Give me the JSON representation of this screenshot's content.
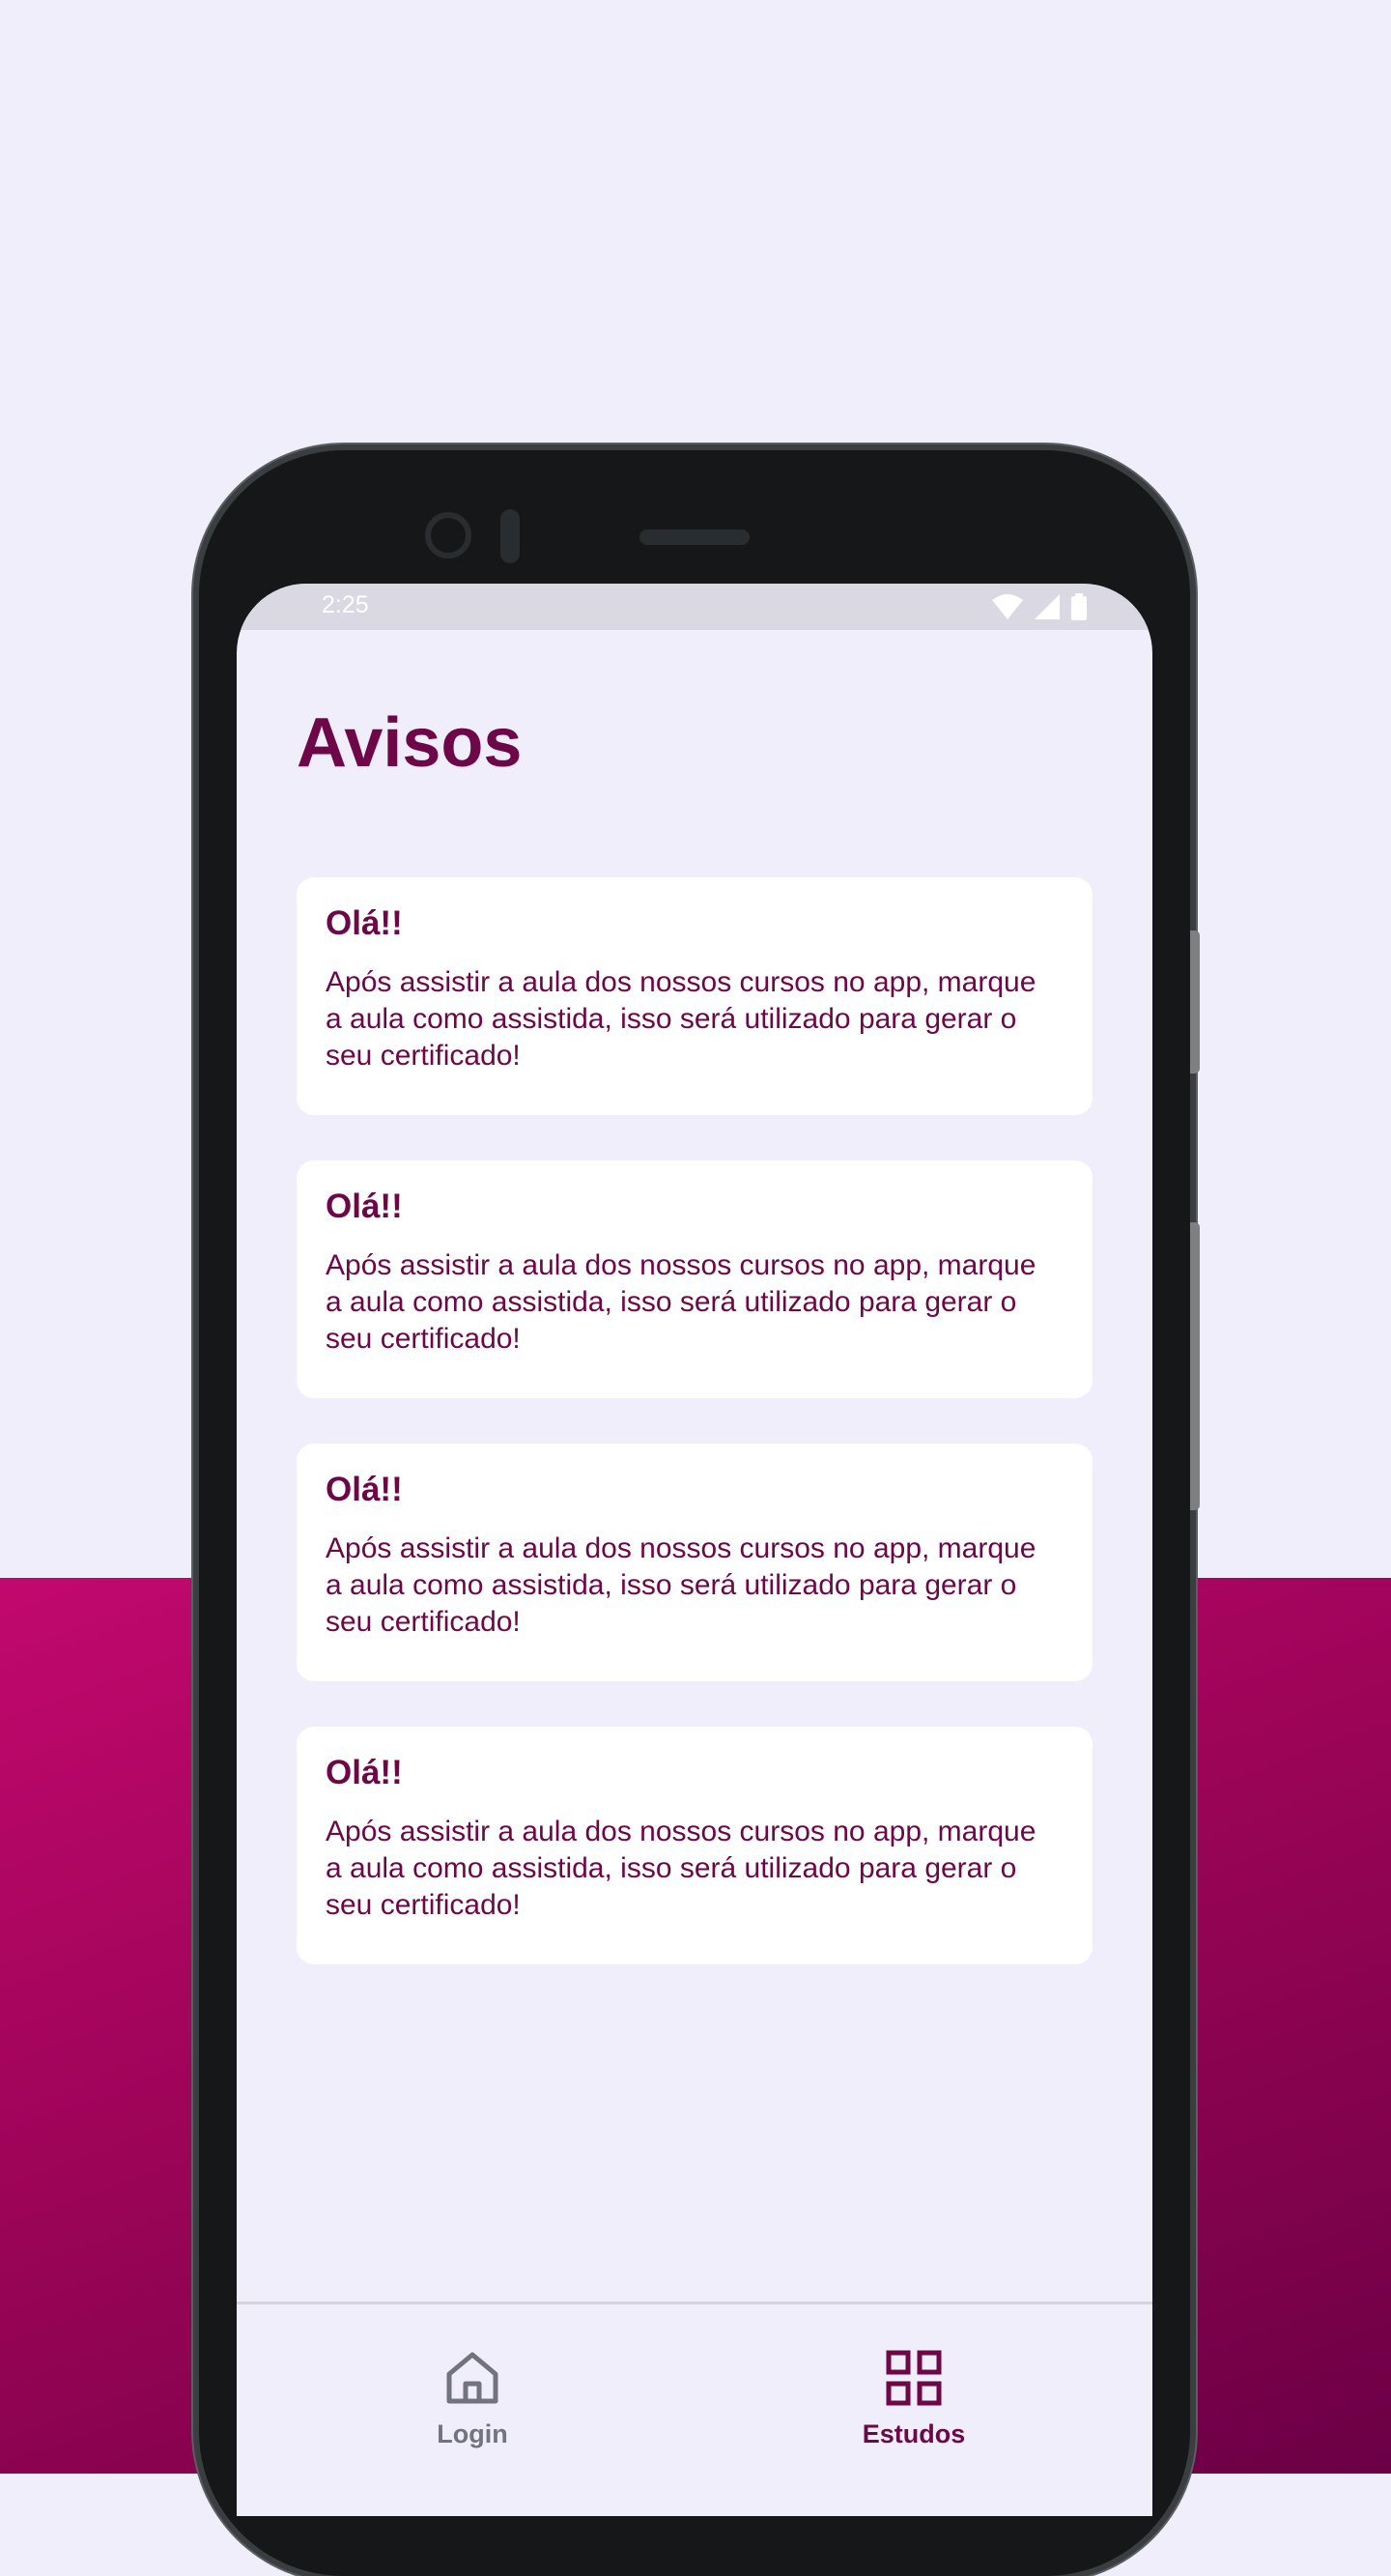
{
  "status_bar": {
    "time": "2:25",
    "icons": [
      "wifi-icon",
      "signal-icon",
      "battery-icon"
    ]
  },
  "page": {
    "title": "Avisos"
  },
  "notices": [
    {
      "title": "Olá!!",
      "body": "Após assistir a aula dos nossos cursos no app, marque a aula como assistida, isso será utilizado para gerar o seu certificado!"
    },
    {
      "title": "Olá!!",
      "body": "Após assistir a aula dos nossos cursos no app, marque a aula como assistida, isso será utilizado para gerar o seu certificado!"
    },
    {
      "title": "Olá!!",
      "body": "Após assistir a aula dos nossos cursos no app, marque a aula como assistida, isso será utilizado para gerar o seu certificado!"
    },
    {
      "title": "Olá!!",
      "body": "Após assistir a aula dos nossos cursos no app, marque a aula como assistida, isso será utilizado para gerar o seu certificado!"
    }
  ],
  "bottom_nav": {
    "items": [
      {
        "label": "Login",
        "icon": "home-icon",
        "active": false
      },
      {
        "label": "Estudos",
        "icon": "grid-icon",
        "active": true
      }
    ]
  },
  "colors": {
    "primary": "#6E0747",
    "background": "#EFEEFA",
    "card": "#FFFFFF",
    "inactive_nav": "#737380",
    "gradient_start": "#C2086E",
    "gradient_end": "#6B0045"
  }
}
